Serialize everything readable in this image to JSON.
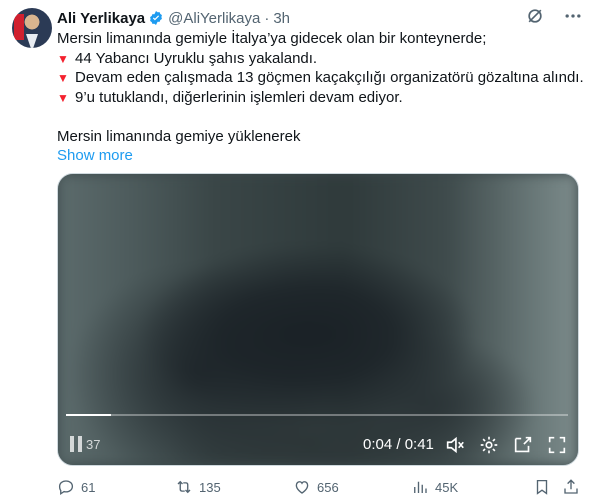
{
  "author": {
    "name": "Ali Yerlikaya",
    "handle": "@AliYerlikaya",
    "separator": "·",
    "time": "3h"
  },
  "tweet": {
    "line1": "Mersin limanında gemiyle İtalya’ya gidecek olan bir konteynerde;",
    "bullet_symbol": "▼",
    "bullets": [
      "44 Yabancı Uyruklu şahıs yakalandı.",
      "Devam eden çalışmada 13 göçmen kaçakçılığı organizatörü gözaltına alındı.",
      "9’u tutuklandı, diğerlerinin işlemleri devam ediyor."
    ],
    "line_after": "Mersin limanında gemiye yüklenerek",
    "show_more": "Show more"
  },
  "video": {
    "pause_label": "37",
    "timecode": "0:04 / 0:41",
    "progress_fraction": 0.09
  },
  "actions": {
    "replies": "61",
    "reposts": "135",
    "likes": "656",
    "views": "45K"
  },
  "colors": {
    "accent": "#1d9bf0",
    "bullet_red": "#f4212e",
    "muted": "#536471"
  }
}
